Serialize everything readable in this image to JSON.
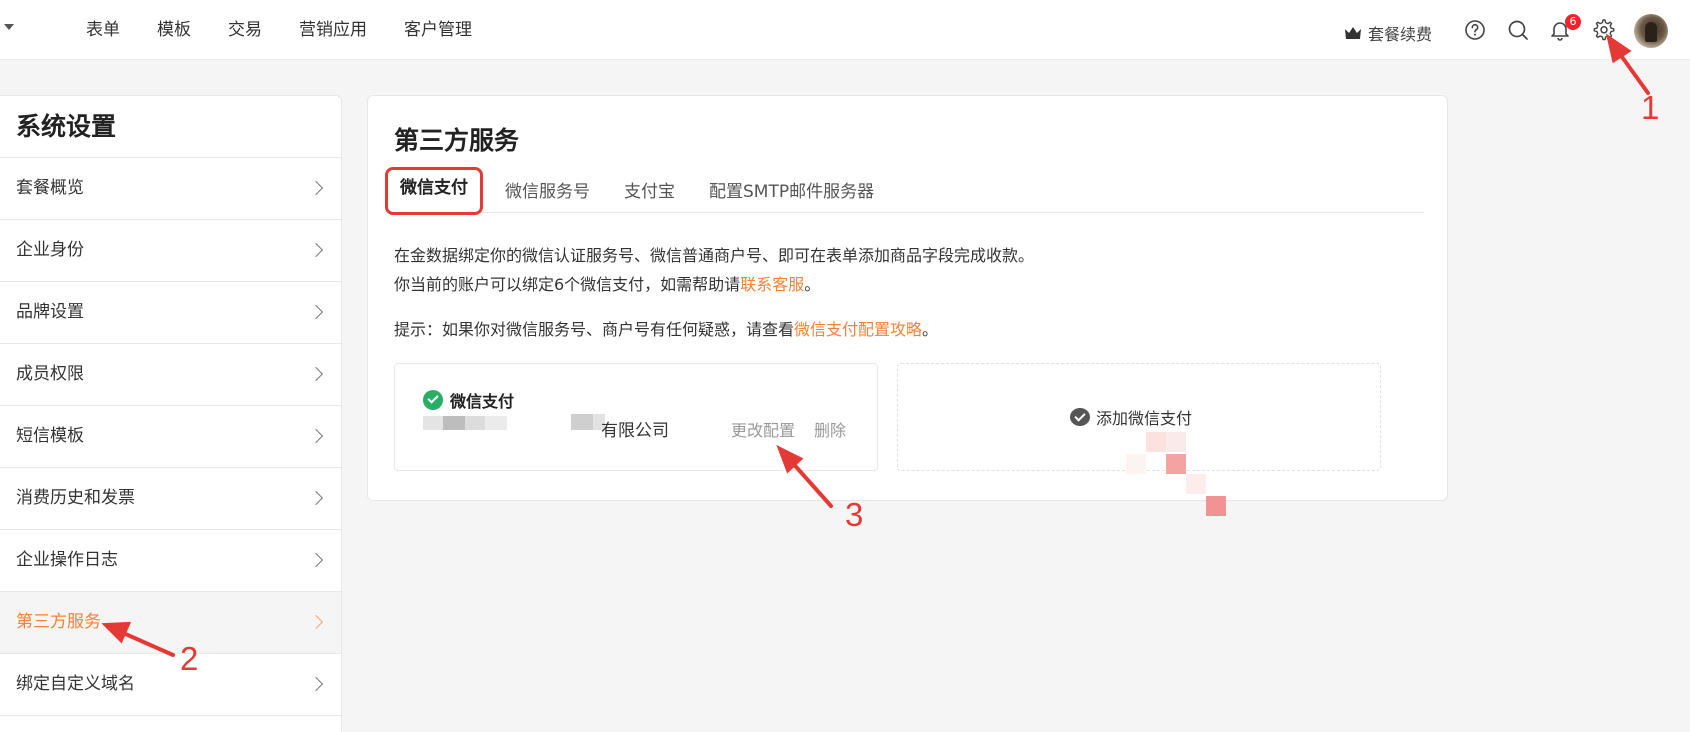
{
  "topnav": {
    "items": [
      "表单",
      "模板",
      "交易",
      "营销应用",
      "客户管理"
    ],
    "renew_label": "套餐续费",
    "notification_count": "6"
  },
  "sidebar": {
    "title": "系统设置",
    "items": [
      {
        "label": "套餐概览"
      },
      {
        "label": "企业身份"
      },
      {
        "label": "品牌设置"
      },
      {
        "label": "成员权限"
      },
      {
        "label": "短信模板"
      },
      {
        "label": "消费历史和发票"
      },
      {
        "label": "企业操作日志"
      },
      {
        "label": "第三方服务",
        "active": true
      },
      {
        "label": "绑定自定义域名"
      }
    ]
  },
  "main": {
    "title": "第三方服务",
    "tabs": [
      {
        "label": "微信支付",
        "active": true
      },
      {
        "label": "微信服务号"
      },
      {
        "label": "支付宝"
      },
      {
        "label": "配置SMTP邮件服务器"
      }
    ],
    "desc_line1": "在金数据绑定你的微信认证服务号、微信普通商户号、即可在表单添加商品字段完成收款。",
    "desc_line2_prefix": "你当前的账户可以绑定6个微信支付，如需帮助请",
    "desc_line2_link": "联系客服",
    "desc_line2_suffix": "。",
    "tip_prefix": "提示：如果你对微信服务号、商户号有任何疑惑，请查看",
    "tip_link": "微信支付配置攻略",
    "tip_suffix": "。",
    "pay_card": {
      "name": "微信支付",
      "company_suffix": "有限公司",
      "edit_label": "更改配置",
      "delete_label": "删除"
    },
    "add_card": {
      "label": "添加微信支付"
    }
  },
  "annotations": [
    "1",
    "2",
    "3"
  ],
  "colors": {
    "accent": "#f5813b",
    "annotation_red": "#e53935",
    "wechat_green": "#2aae67",
    "badge_red": "#f5222d"
  },
  "icons": [
    "crown-icon",
    "help-icon",
    "search-icon",
    "bell-icon",
    "gear-icon",
    "wechat-pay-icon",
    "wechat-icon",
    "chevron-right-icon"
  ]
}
